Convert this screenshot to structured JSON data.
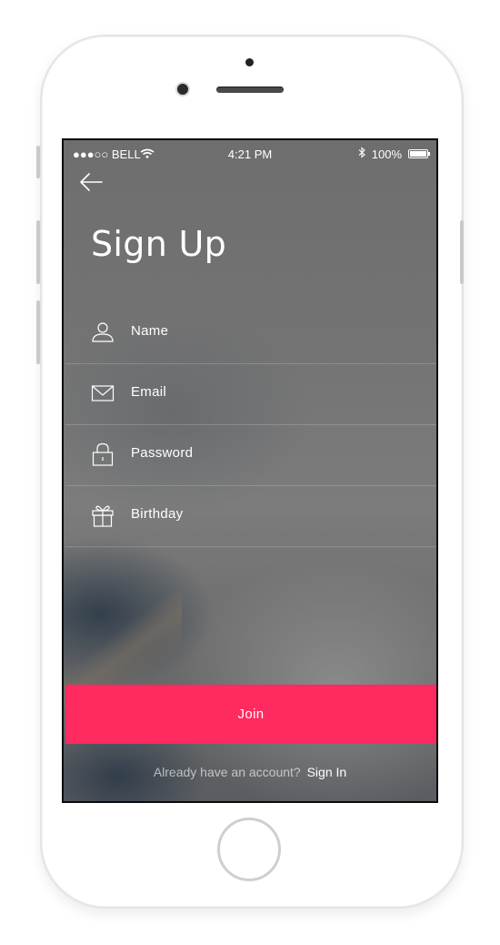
{
  "status_bar": {
    "carrier": "●●●○○ BELL",
    "time": "4:21 PM",
    "battery": "100%"
  },
  "header": {
    "title": "Sign Up"
  },
  "form": {
    "fields": [
      {
        "label": "Name",
        "icon": "user-icon"
      },
      {
        "label": "Email",
        "icon": "mail-icon"
      },
      {
        "label": "Password",
        "icon": "lock-icon"
      },
      {
        "label": "Birthday",
        "icon": "gift-icon"
      }
    ]
  },
  "actions": {
    "join_label": "Join"
  },
  "footer": {
    "question": "Already have an account?",
    "signin_label": "Sign In"
  },
  "colors": {
    "accent": "#ff2a5f",
    "text": "#ffffff"
  }
}
